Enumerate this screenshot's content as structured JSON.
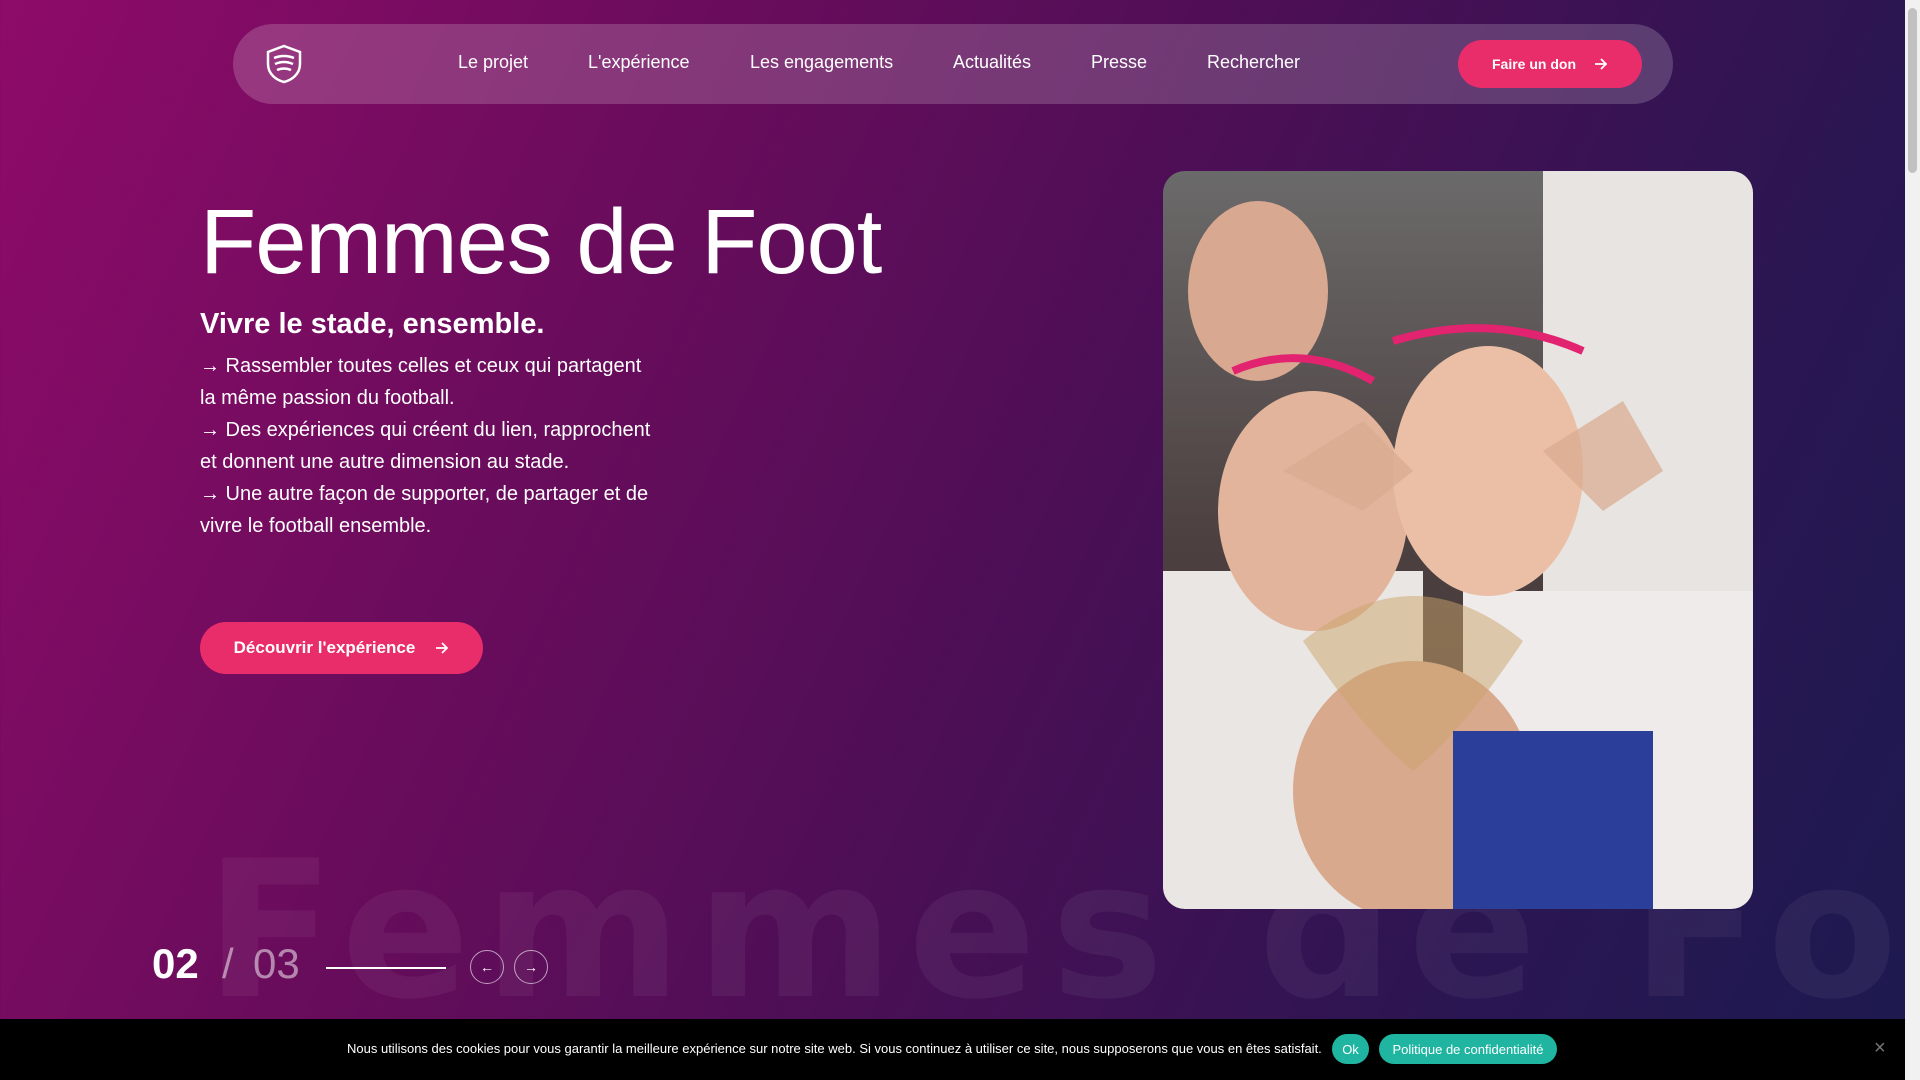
{
  "nav": {
    "logo_icon": "shield-logo-icon",
    "items": [
      "Le projet",
      "L'expérience",
      "Les engagements",
      "Actualités",
      "Presse",
      "Rechercher"
    ],
    "don_label": "Faire un don",
    "don_icon": "arrow-right-icon"
  },
  "hero": {
    "title": "Femmes de Foot",
    "subtitle": "Vivre le stade, ensemble.",
    "lines": [
      "→ Rassembler toutes celles et ceux qui partagent la même passion du football.",
      "→ Des expériences qui créent du lien, rapprochent et donnent une autre dimension au stade.",
      "→ Une autre façon de supporter, de partager et de vivre le football ensemble."
    ],
    "cta_label": "Découvrir l'expérience",
    "cta_icon": "arrow-right-icon"
  },
  "watermark": "Femmes de Foot",
  "slider": {
    "current": "02",
    "separator": "/",
    "total": "03",
    "prev_icon": "←",
    "next_icon": "→"
  },
  "cookie": {
    "text": "Nous utilisons des cookies pour vous garantir la meilleure expérience sur notre site web. Si vous continuez à utiliser ce site, nous supposerons que vous en êtes satisfait.",
    "ok_label": "Ok",
    "policy_label": "Politique de confidentialité",
    "close_glyph": "×"
  },
  "colors": {
    "accent": "#e92c6a",
    "cookie_button": "#1fb5a0",
    "cookie_bg": "#000000"
  }
}
